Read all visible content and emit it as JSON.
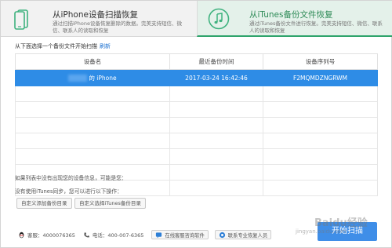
{
  "tabs": [
    {
      "title": "从iPhone设备扫描恢复",
      "desc": "通过扫描iPhone设备恢复删除的数据。完美支持短信、微信、联系人的读取和恢复",
      "icon": "phone-icon"
    },
    {
      "title": "从iTunes备份文件恢复",
      "desc": "通过iTunes备份文件进行恢复。完美支持短信、微信、联系人的读取和恢复",
      "icon": "music-note-icon"
    }
  ],
  "instruction": {
    "text": "从下面选择一个备份文件开始扫描",
    "refresh": "刷新"
  },
  "table": {
    "headers": [
      "设备名",
      "最近备份时间",
      "设备序列号"
    ],
    "rows": [
      {
        "device": "的 iPhone",
        "time": "2017-03-24 16:42:46",
        "serial": "F2MQMDZNGRWM",
        "selected": true
      }
    ],
    "empty_rows": 7
  },
  "notes": {
    "line1": "如果列表中没有出现您的设备信息，可能是您：",
    "line2": "没有使用iTunes同步，您可以进行以下操作："
  },
  "buttons": {
    "custom_dir": "自定义添加备份目录",
    "custom_itunes": "自定义选择iTunes备份目录",
    "start": "开始扫描"
  },
  "footer": {
    "qq": "客服：4000076365",
    "phone": "电话：400-007-6365",
    "online_btn": "在线客服咨询软件",
    "vip_btn": "联系专业恢复人员"
  },
  "watermark": {
    "text": "Baidu经验",
    "url": "jingyan.baidu.com"
  },
  "colors": {
    "accent_green": "#2e8b57",
    "selected_row": "#2e8ce6",
    "start_button": "#3f8ee8"
  }
}
